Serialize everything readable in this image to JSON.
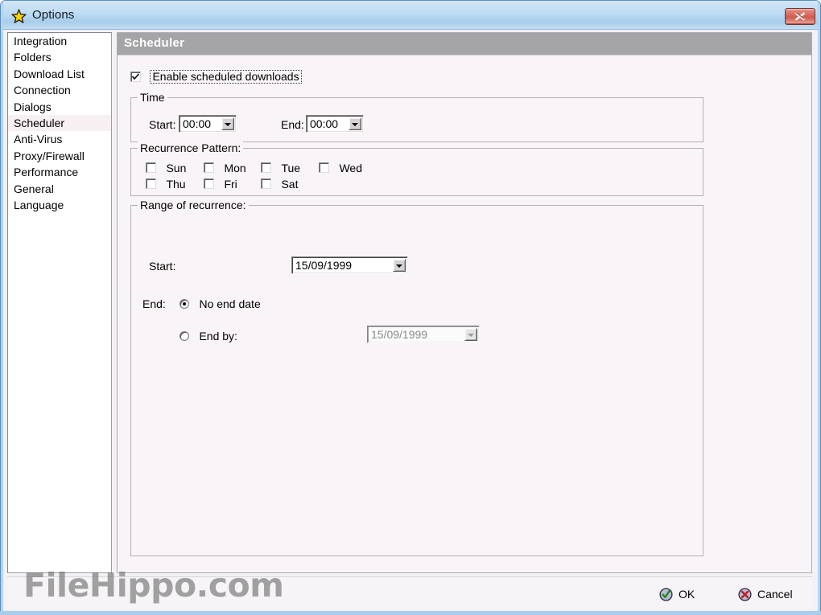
{
  "window": {
    "title": "Options",
    "star_icon": "star-icon",
    "close_icon": "close-icon"
  },
  "sidebar": {
    "items": [
      {
        "label": "Integration",
        "selected": false
      },
      {
        "label": "Folders",
        "selected": false
      },
      {
        "label": "Download List",
        "selected": false
      },
      {
        "label": "Connection",
        "selected": false
      },
      {
        "label": "Dialogs",
        "selected": false
      },
      {
        "label": "Scheduler",
        "selected": true
      },
      {
        "label": "Anti-Virus",
        "selected": false
      },
      {
        "label": "Proxy/Firewall",
        "selected": false
      },
      {
        "label": "Performance",
        "selected": false
      },
      {
        "label": "General",
        "selected": false
      },
      {
        "label": "Language",
        "selected": false
      }
    ]
  },
  "panel": {
    "header": "Scheduler",
    "enable": {
      "label": "Enable scheduled downloads",
      "checked": true
    },
    "time": {
      "title": "Time",
      "start_label": "Start:",
      "start_value": "00:00",
      "end_label": "End:",
      "end_value": "00:00"
    },
    "recurrence": {
      "title": "Recurrence Pattern:",
      "days": [
        {
          "label": "Sun",
          "checked": false
        },
        {
          "label": "Mon",
          "checked": false
        },
        {
          "label": "Tue",
          "checked": false
        },
        {
          "label": "Wed",
          "checked": false
        },
        {
          "label": "Thu",
          "checked": false
        },
        {
          "label": "Fri",
          "checked": false
        },
        {
          "label": "Sat",
          "checked": false
        }
      ]
    },
    "range": {
      "title": "Range of recurrence:",
      "start_label": "Start:",
      "start_value": "15/09/1999",
      "end_label": "End:",
      "no_end_date_label": "No end date",
      "no_end_date_selected": true,
      "end_by_label": "End by:",
      "end_by_selected": false,
      "end_by_value": "15/09/1999",
      "end_by_disabled": true
    }
  },
  "footer": {
    "ok_label": "OK",
    "ok_icon": "check-circle-icon",
    "cancel_label": "Cancel",
    "cancel_icon": "x-circle-icon"
  },
  "watermark": {
    "text": "FileHippo.com"
  },
  "colors": {
    "titlebar": "#bfdcf3",
    "panel_header": "#a5a5a8",
    "panel_bg": "#f9f4f7",
    "close_button": "#cf5b4e",
    "ok_icon": "#2f9e2f",
    "cancel_icon": "#cc2222",
    "selection": "#f7eff2"
  }
}
